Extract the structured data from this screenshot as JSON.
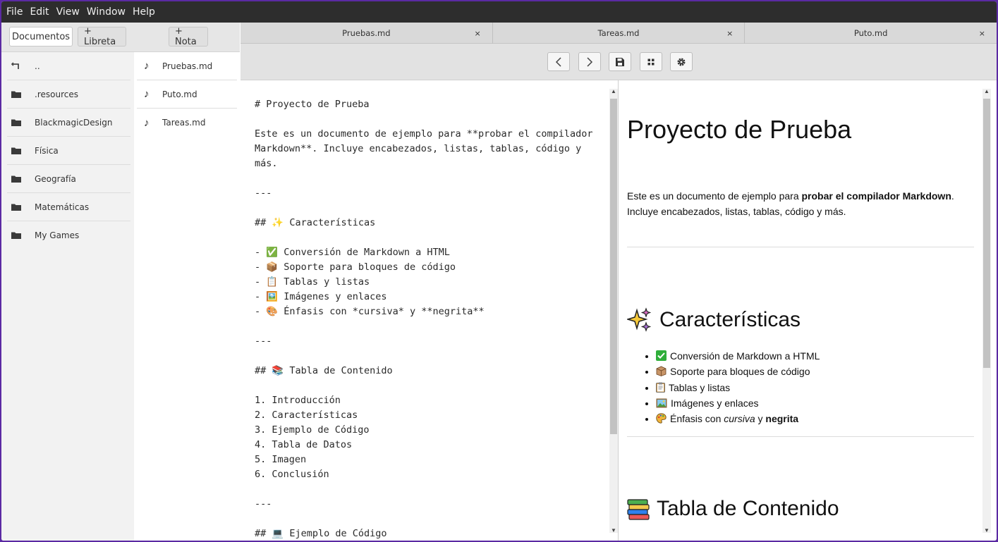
{
  "menubar": {
    "items": [
      "File",
      "Edit",
      "View",
      "Window",
      "Help"
    ]
  },
  "sidebar": {
    "buttons": {
      "documents": "Documentos",
      "add_notebook": "+ Libreta",
      "add_note": "+ Nota"
    },
    "folders": [
      "..",
      " .resources",
      "BlackmagicDesign",
      "Física",
      "Geografía",
      "Matemáticas",
      "My Games"
    ],
    "files": [
      "Pruebas.md",
      "Puto.md",
      "Tareas.md"
    ]
  },
  "tabs": [
    {
      "label": "Pruebas.md",
      "close": "×"
    },
    {
      "label": "Tareas.md",
      "close": "×"
    },
    {
      "label": "Puto.md",
      "close": "×"
    }
  ],
  "editor": {
    "text": "# Proyecto de Prueba\n\nEste es un documento de ejemplo para **probar el compilador Markdown**. Incluye encabezados, listas, tablas, código y más.\n\n---\n\n## ✨ Características\n\n- ✅ Conversión de Markdown a HTML\n- 📦 Soporte para bloques de código\n- 📋 Tablas y listas\n- 🖼️ Imágenes y enlaces\n- 🎨 Énfasis con *cursiva* y **negrita**\n\n---\n\n## 📚 Tabla de Contenido\n\n1. Introducción\n2. Características\n3. Ejemplo de Código\n4. Tabla de Datos\n5. Imagen\n6. Conclusión\n\n---\n\n## 💻 Ejemplo de Código"
  },
  "preview": {
    "h1": "Proyecto de Prueba",
    "para_pre": "Este es un documento de ejemplo para ",
    "para_bold": "probar el compilador Markdown",
    "para_post": ". Incluye encabezados, listas, tablas, código y más.",
    "h2_features": "Características",
    "features": [
      "Conversión de Markdown a HTML",
      "Soporte para bloques de código",
      "Tablas y listas",
      "Imágenes y enlaces"
    ],
    "emphasis_pre": "Énfasis con ",
    "emphasis_italic": "cursiva",
    "emphasis_mid": " y ",
    "emphasis_bold": "negrita",
    "h2_toc": "Tabla de Contenido"
  }
}
